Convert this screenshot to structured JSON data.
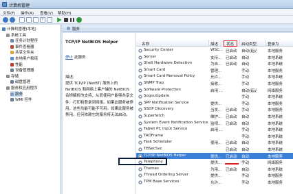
{
  "window": {
    "title": "计算机管理"
  },
  "menu": [
    "文件(F)",
    "操作(A)",
    "查看(V)",
    "帮助(H)"
  ],
  "tree": [
    {
      "label": "计算机管理(本地)",
      "level": 0,
      "color": "#4f7fb8"
    },
    {
      "label": "系统工具",
      "level": 1,
      "color": "#8a8f96"
    },
    {
      "label": "任务计划程序",
      "level": 2,
      "color": "#6b88b0"
    },
    {
      "label": "事件查看器",
      "level": 2,
      "color": "#b0492f"
    },
    {
      "label": "共享文件夹",
      "level": 2,
      "color": "#d9a63a"
    },
    {
      "label": "本地用户和组",
      "level": 2,
      "color": "#5a8fc9"
    },
    {
      "label": "性能",
      "level": 2,
      "color": "#c0392b"
    },
    {
      "label": "设备管理器",
      "level": 2,
      "color": "#6a7d92"
    },
    {
      "label": "存储",
      "level": 1,
      "color": "#8a8f96"
    },
    {
      "label": "磁盘管理",
      "level": 2,
      "color": "#6a7d92"
    },
    {
      "label": "服务和应用程序",
      "level": 1,
      "color": "#8a8f96"
    },
    {
      "label": "服务",
      "level": 2,
      "color": "#7f9bbf",
      "selected": true
    },
    {
      "label": "WMI 控件",
      "level": 2,
      "color": "#6a7d92"
    }
  ],
  "content_header": "服务",
  "detail": {
    "service_name": "TCP/IP NetBIOS Helper",
    "stop_link": "停止",
    "stop_rest": "此服务",
    "desc_title": "描述:",
    "desc_text": "提供 TCP/IP (NetBT) 服务上的 NetBIOS 和网络上客户端的 NetBIOS 名称解析的支持，从而使用户能够共享文件、打印和登录到网络。如果此服务被停用，这些功能可能不可用。如果此服务被禁用，任何依赖它的服务将无法启动。"
  },
  "columns": {
    "name": "名称",
    "desc": "描述",
    "status": "状态",
    "start": "启动类型",
    "logon": "登录为"
  },
  "services": [
    {
      "name": "Security Center",
      "desc": "WSC...",
      "status": "已启动",
      "start": "自动(延迟...",
      "logon": "本地服务"
    },
    {
      "name": "Server",
      "desc": "支持...",
      "status": "已启动",
      "start": "自动",
      "logon": "本地系统"
    },
    {
      "name": "Shell Hardware Detection",
      "desc": "为自...",
      "status": "已启动",
      "start": "自动",
      "logon": "本地系统"
    },
    {
      "name": "Smart Card",
      "desc": "管理...",
      "status": "",
      "start": "手动",
      "logon": "本地服务"
    },
    {
      "name": "Smart Card Removal Policy",
      "desc": "允许...",
      "status": "",
      "start": "手动",
      "logon": "本地系统"
    },
    {
      "name": "SNMP Trap",
      "desc": "接收...",
      "status": "",
      "start": "手动",
      "logon": "本地服务"
    },
    {
      "name": "Software Protection",
      "desc": "启用 ...",
      "status": "",
      "start": "自动(延迟...",
      "logon": "网络服务"
    },
    {
      "name": "SogouUpdate",
      "desc": "",
      "status": "",
      "start": "手动",
      "logon": "本地系统"
    },
    {
      "name": "SPP Notification Service",
      "desc": "提供...",
      "status": "",
      "start": "手动",
      "logon": "本地服务"
    },
    {
      "name": "SSDP Discovery",
      "desc": "当发...",
      "status": "已启动",
      "start": "手动",
      "logon": "本地服务"
    },
    {
      "name": "Superfetch",
      "desc": "维护...",
      "status": "已启动",
      "start": "自动",
      "logon": "本地系统"
    },
    {
      "name": "System Event Notification Service",
      "desc": "监视...",
      "status": "已启动",
      "start": "自动",
      "logon": "本地系统"
    },
    {
      "name": "Tablet PC Input Service",
      "desc": "启用 ...",
      "status": "",
      "start": "手动",
      "logon": "本地系统"
    },
    {
      "name": "TAOFrame",
      "desc": "",
      "status": "",
      "start": "手动",
      "logon": "本地系统"
    },
    {
      "name": "Task Scheduler",
      "desc": "使用...",
      "status": "已启动",
      "start": "自动",
      "logon": "本地系统"
    },
    {
      "name": "TBSecSvc",
      "desc": "",
      "status": "已启动",
      "start": "自动",
      "logon": "本地系统"
    },
    {
      "name": "TCP/IP NetBIOS Helper",
      "desc": "提供...",
      "status": "已启动",
      "start": "自动",
      "logon": "本地服务",
      "selected": true
    },
    {
      "name": "Telephony",
      "desc": "提供...",
      "status": "",
      "start": "手动",
      "logon": "网络服务"
    },
    {
      "name": "Themes",
      "desc": "为用...",
      "status": "已启动",
      "start": "自动",
      "logon": "本地系统"
    },
    {
      "name": "Thread Ordering Server",
      "desc": "提供...",
      "status": "",
      "start": "手动",
      "logon": "本地服务"
    },
    {
      "name": "TPM Base Services",
      "desc": "允许...",
      "status": "",
      "start": "手动",
      "logon": "本地服务"
    }
  ]
}
